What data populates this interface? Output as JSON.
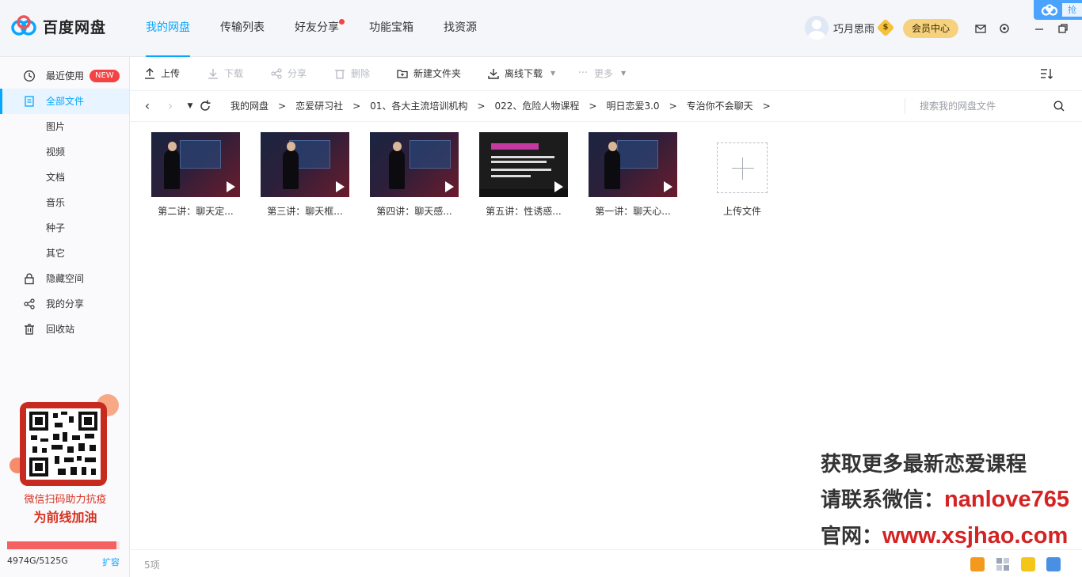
{
  "app": {
    "name": "百度网盘"
  },
  "nav": [
    {
      "label": "我的网盘",
      "active": true,
      "dot": false
    },
    {
      "label": "传输列表",
      "active": false,
      "dot": false
    },
    {
      "label": "好友分享",
      "active": false,
      "dot": true
    },
    {
      "label": "功能宝箱",
      "active": false,
      "dot": false
    },
    {
      "label": "找资源",
      "active": false,
      "dot": false
    }
  ],
  "user": {
    "name": "巧月思雨",
    "vip_badge": "$",
    "member_center": "会员中心"
  },
  "top_badge": {
    "text": "抢"
  },
  "sidebar": {
    "items": [
      {
        "label": "最近使用",
        "icon": "clock-icon",
        "glyph": "◷",
        "badge": "NEW"
      },
      {
        "label": "全部文件",
        "icon": "file-icon",
        "glyph": "▤",
        "active": true
      },
      {
        "label": "图片"
      },
      {
        "label": "视频"
      },
      {
        "label": "文档"
      },
      {
        "label": "音乐"
      },
      {
        "label": "种子"
      },
      {
        "label": "其它"
      },
      {
        "label": "隐藏空间",
        "icon": "lock-icon",
        "glyph": "🔒"
      },
      {
        "label": "我的分享",
        "icon": "share-icon",
        "glyph": "⋰"
      },
      {
        "label": "回收站",
        "icon": "trash-icon",
        "glyph": "🗑"
      }
    ],
    "promo": {
      "line1": "微信扫码助力抗疫",
      "line2": "为前线加油"
    },
    "quota": {
      "text": "4974G/5125G",
      "expand": "扩容",
      "used": 4974,
      "total": 5125
    }
  },
  "toolbar": {
    "upload": "上传",
    "download": "下载",
    "share": "分享",
    "delete": "删除",
    "new_folder": "新建文件夹",
    "offline": "离线下载",
    "more": "更多"
  },
  "breadcrumb": [
    "我的网盘",
    "恋爱研习社",
    "01、各大主流培训机构",
    "022、危险人物课程",
    "明日恋爱3.0",
    "专治你不会聊天"
  ],
  "search": {
    "placeholder": "搜索我的网盘文件"
  },
  "files": [
    {
      "name": "第二讲：聊天定...",
      "thumb": "video-lecture"
    },
    {
      "name": "第三讲：聊天框...",
      "thumb": "video-lecture"
    },
    {
      "name": "第四讲：聊天感...",
      "thumb": "video-lecture"
    },
    {
      "name": "第五讲：性诱惑...",
      "thumb": "video-slide"
    },
    {
      "name": "第一讲：聊天心...",
      "thumb": "video-lecture"
    }
  ],
  "upload_tile": {
    "label": "上传文件"
  },
  "status": {
    "count": "5项"
  },
  "watermark": {
    "line1": "获取更多最新恋爱课程",
    "line2_prefix": "请联系微信：",
    "line2_value": "nanlove765",
    "line3_prefix": "官网：",
    "line3_value": "www.xsjhao.com"
  },
  "colors": {
    "accent": "#06a7ff",
    "alert": "#f54242",
    "vip": "#f6d27f"
  }
}
